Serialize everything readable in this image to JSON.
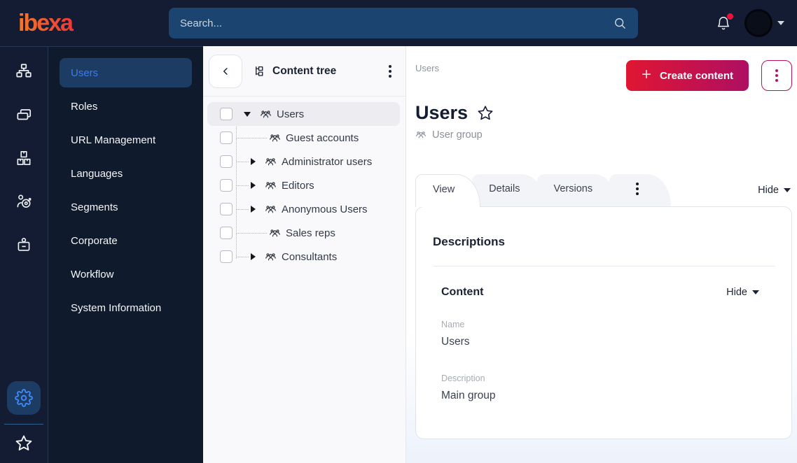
{
  "brand": {
    "logo_text": "ibexa"
  },
  "topbar": {
    "search_placeholder": "Search...",
    "icons": [
      "search-icon",
      "bell-icon",
      "avatar",
      "chevron-down-icon"
    ]
  },
  "icon_rail": {
    "top_icons": [
      {
        "name": "sitemap-icon"
      },
      {
        "name": "pages-icon"
      },
      {
        "name": "boxes-icon"
      },
      {
        "name": "personalization-target-icon"
      },
      {
        "name": "admin-badge-icon"
      }
    ],
    "bottom_icons": [
      {
        "name": "gear-icon",
        "active": true
      },
      {
        "name": "star-icon"
      }
    ]
  },
  "sidebar": {
    "items": [
      {
        "label": "Users",
        "selected": true
      },
      {
        "label": "Roles"
      },
      {
        "label": "URL Management"
      },
      {
        "label": "Languages"
      },
      {
        "label": "Segments"
      },
      {
        "label": "Corporate"
      },
      {
        "label": "Workflow"
      },
      {
        "label": "System Information"
      }
    ]
  },
  "content_tree": {
    "title": "Content tree",
    "items": [
      {
        "label": "Users",
        "state": "expanded",
        "selected": true,
        "level": 0
      },
      {
        "label": "Guest accounts",
        "state": "leaf",
        "level": 1
      },
      {
        "label": "Administrator users",
        "state": "collapsed",
        "level": 1
      },
      {
        "label": "Editors",
        "state": "collapsed",
        "level": 1
      },
      {
        "label": "Anonymous Users",
        "state": "collapsed",
        "level": 1
      },
      {
        "label": "Sales reps",
        "state": "leaf",
        "level": 1
      },
      {
        "label": "Consultants",
        "state": "collapsed",
        "level": 1
      }
    ]
  },
  "main": {
    "breadcrumb": "Users",
    "create_button": "Create content",
    "title": "Users",
    "content_type": "User group",
    "tabs": [
      {
        "label": "View",
        "active": true
      },
      {
        "label": "Details"
      },
      {
        "label": "Versions"
      }
    ],
    "hide_toggle": "Hide",
    "card": {
      "heading": "Descriptions",
      "section_title": "Content",
      "section_toggle": "Hide",
      "fields": [
        {
          "label": "Name",
          "value": "Users"
        },
        {
          "label": "Description",
          "value": "Main group"
        }
      ]
    }
  },
  "colors": {
    "topbar_bg": "#131c33",
    "search_bg": "#1b4470",
    "selected_menu_bg": "#1c3c64",
    "selected_menu_text": "#3d7ce8",
    "accent_gradient_start": "#e01632",
    "accent_gradient_end": "#ae0f63",
    "notification_dot": "#e8143c",
    "selected_tree_row": "#ececf1"
  }
}
